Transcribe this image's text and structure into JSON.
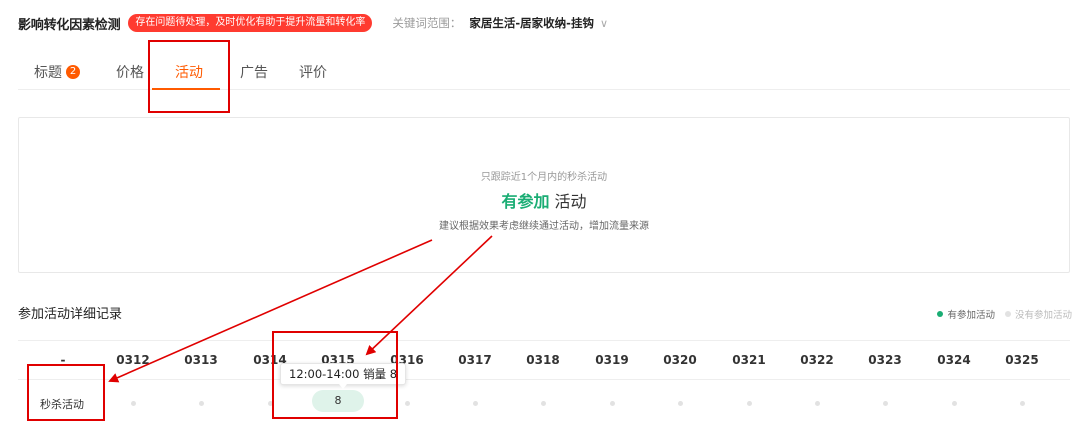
{
  "header": {
    "title": "影响转化因素检测",
    "badge": "存在问题待处理，及时优化有助于提升流量和转化率",
    "keyword_label": "关键词范围：",
    "keyword_value": "家居生活-居家收纳-挂钩",
    "keyword_chevron": "∨"
  },
  "tabs": [
    {
      "label": "标题",
      "badge": "2"
    },
    {
      "label": "价格"
    },
    {
      "label": "活动",
      "active": true
    },
    {
      "label": "广告"
    },
    {
      "label": "评价"
    }
  ],
  "card": {
    "subtitle": "只跟踪近1个月内的秒杀活动",
    "status_highlight": "有参加",
    "status_rest": " 活动",
    "tip": "建议根据效果考虑继续通过活动，增加流量来源"
  },
  "section": {
    "title": "参加活动详细记录",
    "legend_on": "有参加活动",
    "legend_off": "没有参加活动"
  },
  "table": {
    "corner": "-",
    "columns": [
      "0312",
      "0313",
      "0314",
      "0315",
      "0316",
      "0317",
      "0318",
      "0319",
      "0320",
      "0321",
      "0322",
      "0323",
      "0324",
      "0325"
    ],
    "row_label": "秒杀活动",
    "active_value": "8",
    "tooltip": "12:00-14:00 销量 8"
  },
  "colors": {
    "accent": "#ff5a00",
    "green": "#1aad74",
    "badge_red": "#ff3b30",
    "annotation_red": "#e00000"
  }
}
